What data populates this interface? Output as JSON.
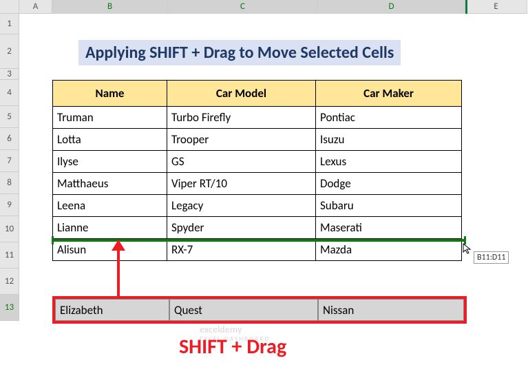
{
  "columns": [
    "A",
    "B",
    "C",
    "D",
    "E"
  ],
  "rows": [
    "1",
    "2",
    "3",
    "4",
    "5",
    "6",
    "7",
    "8",
    "9",
    "10",
    "11",
    "12",
    "13"
  ],
  "title": "Applying SHIFT + Drag to Move Selected Cells",
  "headers": {
    "b": "Name",
    "c": "Car Model",
    "d": "Car Maker"
  },
  "data": [
    {
      "b": "Truman",
      "c": "Turbo Firefly",
      "d": "Pontiac"
    },
    {
      "b": "Lotta",
      "c": "Trooper",
      "d": "Isuzu"
    },
    {
      "b": "Ilyse",
      "c": "GS",
      "d": "Lexus"
    },
    {
      "b": "Matthaeus",
      "c": "Viper RT/10",
      "d": "Dodge"
    },
    {
      "b": "Leena",
      "c": "Legacy",
      "d": "Subaru"
    },
    {
      "b": "Lianne",
      "c": "Spyder",
      "d": "Maserati"
    },
    {
      "b": "Alisun",
      "c": "RX-7",
      "d": "Mazda"
    }
  ],
  "dragged": {
    "b": "Elizabeth",
    "c": "Quest",
    "d": "Nissan"
  },
  "tooltip": "B11:D11",
  "big_label": "SHIFT + Drag",
  "watermark": {
    "main": "exceldemy",
    "sub": "EXCEL DASHBOARD"
  }
}
